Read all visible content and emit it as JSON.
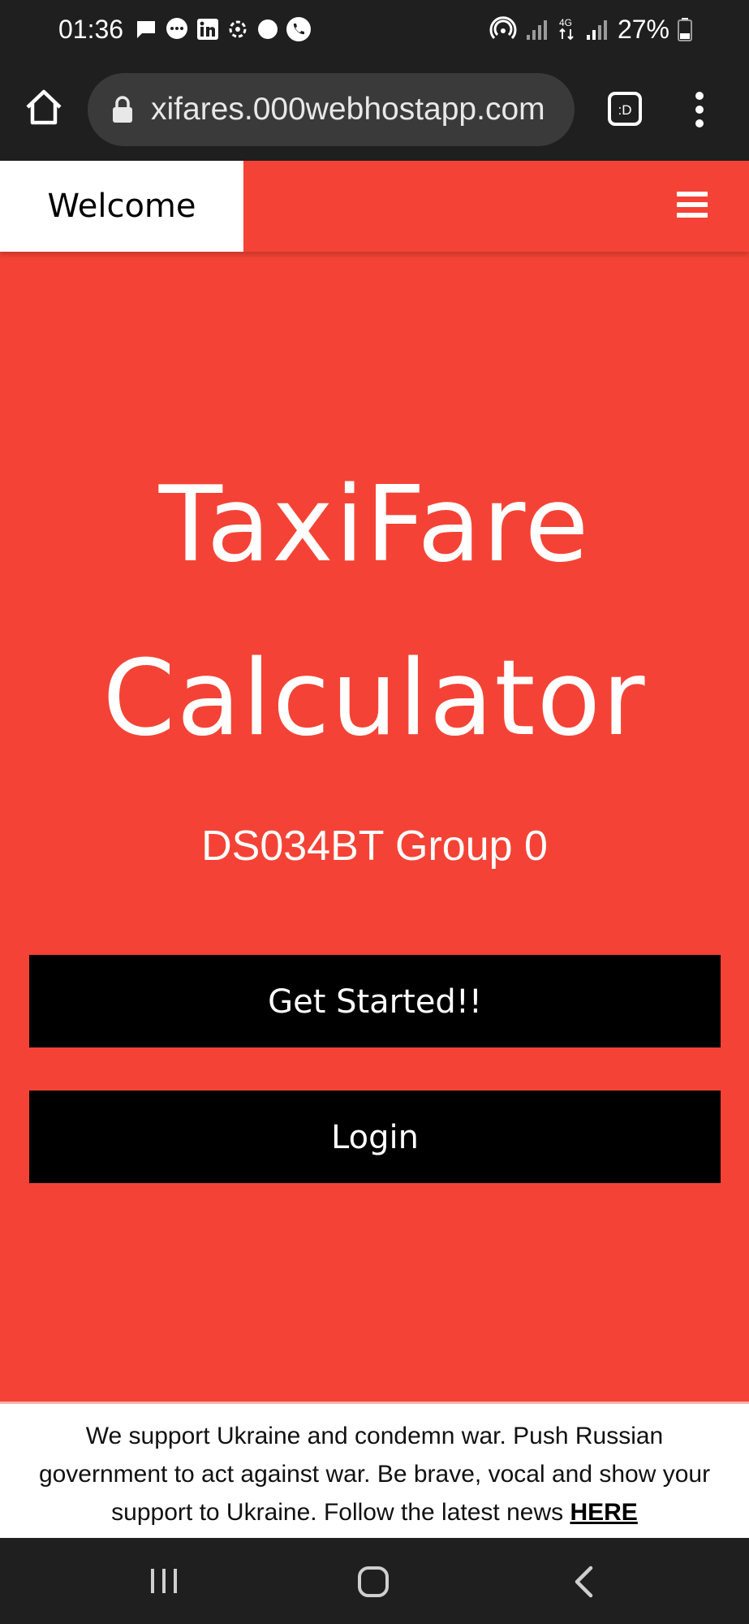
{
  "status_bar": {
    "time": "01:36",
    "battery": "27%",
    "left_icons": [
      "message-icon",
      "chat-bubble-icon",
      "linkedin-icon",
      "vpn-icon",
      "dot-icon",
      "phone-icon"
    ],
    "right_icons": [
      "hotspot-icon",
      "signal-icon",
      "4g-icon",
      "signal-icon",
      "battery-icon"
    ]
  },
  "browser": {
    "url": "xifares.000webhostapp.com",
    "tab_label": ":D"
  },
  "navbar": {
    "welcome": "Welcome",
    "menu_icon": "hamburger-icon"
  },
  "hero": {
    "title_line1": "TaxiFare",
    "title_line2": "Calculator",
    "subtitle": "DS034BT Group 0",
    "get_started": "Get Started!!",
    "login": "Login"
  },
  "banner": {
    "text": "We support Ukraine and condemn war. Push Russian government to act against war. Be brave, vocal and show your support to Ukraine. Follow the latest news ",
    "link": "HERE"
  },
  "colors": {
    "accent": "#f44336",
    "button_bg": "#000000",
    "bar_bg": "#1f1f1f"
  }
}
